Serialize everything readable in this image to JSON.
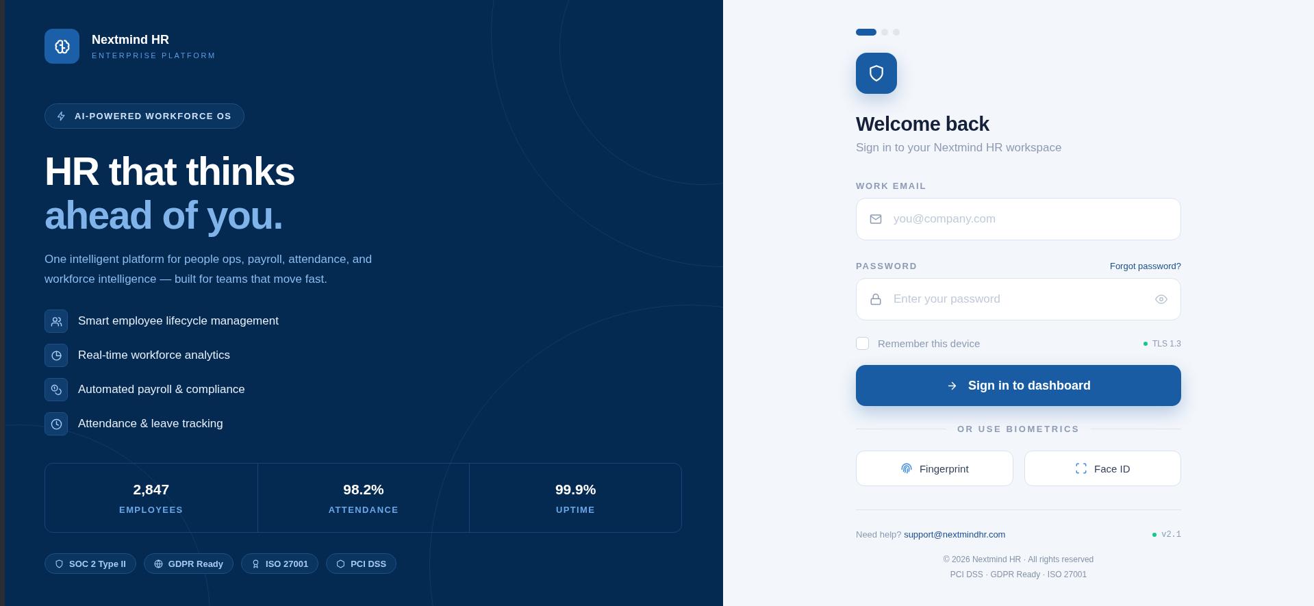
{
  "brand": {
    "name": "Nextmind HR",
    "tagline": "ENTERPRISE PLATFORM"
  },
  "pill": {
    "label": "AI-POWERED WORKFORCE OS"
  },
  "headline": {
    "line_1": "HR that thinks",
    "line_2": "ahead of you."
  },
  "intro": "One intelligent platform for people ops, payroll, attendance, and workforce intelligence — built for teams that move fast.",
  "features": [
    {
      "kind": "users",
      "label": "Smart employee lifecycle management"
    },
    {
      "kind": "pie",
      "label": "Real-time workforce analytics"
    },
    {
      "kind": "coins",
      "label": "Automated payroll & compliance"
    },
    {
      "kind": "clock",
      "label": "Attendance & leave tracking"
    }
  ],
  "stats": [
    {
      "value": "2,847",
      "label": "EMPLOYEES"
    },
    {
      "value": "98.2%",
      "label": "ATTENDANCE"
    },
    {
      "value": "99.9%",
      "label": "UPTIME"
    }
  ],
  "badges": [
    {
      "kind": "shield",
      "label": "SOC 2 Type II"
    },
    {
      "kind": "globe",
      "label": "GDPR Ready"
    },
    {
      "kind": "award",
      "label": "ISO 27001"
    },
    {
      "kind": "hexagon",
      "label": "PCI DSS"
    }
  ],
  "steps": [
    {
      "selected": true
    },
    {
      "selected": false
    },
    {
      "selected": false
    }
  ],
  "login": {
    "title": "Welcome back",
    "subtitle": "Sign in to your Nextmind HR workspace",
    "email": {
      "label": "WORK EMAIL",
      "placeholder": "you@company.com"
    },
    "password": {
      "label": "PASSWORD",
      "placeholder": "Enter your password",
      "forgot_link": "Forgot password?"
    },
    "remember": {
      "label": "Remember this device",
      "checked": false
    },
    "security": "TLS 1.3",
    "submit": "Sign in to dashboard",
    "divider": "OR USE BIOMETRICS",
    "biometrics": [
      {
        "kind": "fingerprint",
        "label": "Fingerprint"
      },
      {
        "kind": "face",
        "label": "Face ID"
      }
    ],
    "help": {
      "prompt": "Need help?",
      "email": "support@nextmindhr.com"
    },
    "version": "v2.1",
    "copyright": "© 2026 Nextmind HR · All rights reserved",
    "compliance": "PCI DSS · GDPR Ready · ISO 27001"
  }
}
